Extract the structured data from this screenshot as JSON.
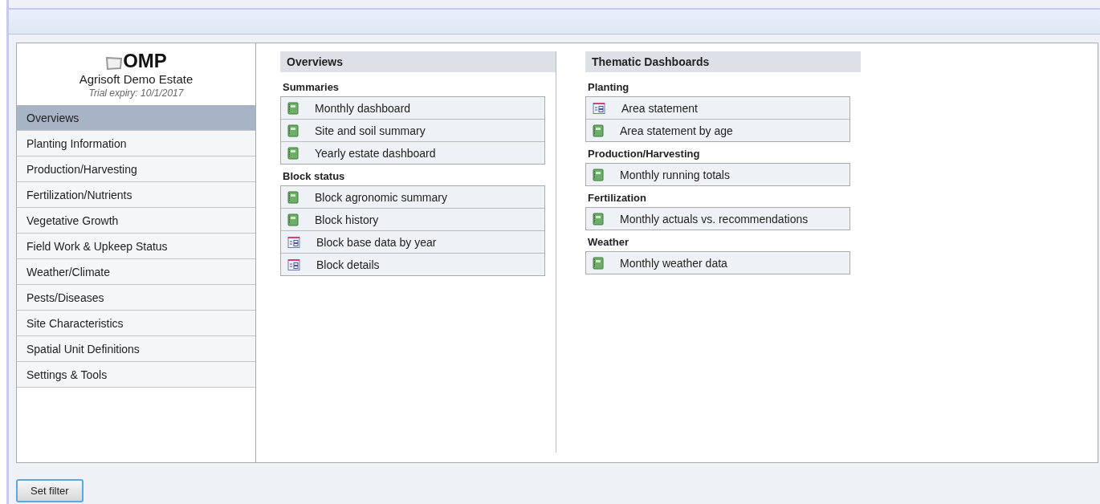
{
  "brand": {
    "logo": "OMP",
    "estate": "Agrisoft Demo Estate",
    "expiry": "Trial expiry: 10/1/2017"
  },
  "sidebar": {
    "items": [
      {
        "label": "Overviews",
        "selected": true
      },
      {
        "label": "Planting Information",
        "selected": false
      },
      {
        "label": "Production/Harvesting",
        "selected": false
      },
      {
        "label": "Fertilization/Nutrients",
        "selected": false
      },
      {
        "label": "Vegetative Growth",
        "selected": false
      },
      {
        "label": "Field Work & Upkeep Status",
        "selected": false
      },
      {
        "label": "Weather/Climate",
        "selected": false
      },
      {
        "label": "Pests/Diseases",
        "selected": false
      },
      {
        "label": "Site Characteristics",
        "selected": false
      },
      {
        "label": "Spatial Unit Definitions",
        "selected": false
      },
      {
        "label": "Settings & Tools",
        "selected": false
      }
    ]
  },
  "panels": [
    {
      "title": "Overviews",
      "groups": [
        {
          "title": "Summaries",
          "items": [
            {
              "label": "Monthly dashboard",
              "kind": "report"
            },
            {
              "label": "Site and soil summary",
              "kind": "report"
            },
            {
              "label": "Yearly estate dashboard",
              "kind": "report"
            }
          ]
        },
        {
          "title": "Block status",
          "items": [
            {
              "label": "Block agronomic summary",
              "kind": "report"
            },
            {
              "label": "Block history",
              "kind": "report"
            },
            {
              "label": "Block base data by year",
              "kind": "form"
            },
            {
              "label": "Block details",
              "kind": "form"
            }
          ]
        }
      ]
    },
    {
      "title": "Thematic Dashboards",
      "groups": [
        {
          "title": "Planting",
          "items": [
            {
              "label": "Area statement",
              "kind": "form"
            },
            {
              "label": "Area statement by age",
              "kind": "report"
            }
          ]
        },
        {
          "title": "Production/Harvesting",
          "items": [
            {
              "label": "Monthly running totals",
              "kind": "report"
            }
          ]
        },
        {
          "title": "Fertilization",
          "items": [
            {
              "label": "Monthly actuals vs. recommendations",
              "kind": "report"
            }
          ]
        },
        {
          "title": "Weather",
          "items": [
            {
              "label": "Monthly weather data",
              "kind": "report"
            }
          ]
        }
      ]
    }
  ],
  "footer": {
    "button": "Set filter"
  }
}
